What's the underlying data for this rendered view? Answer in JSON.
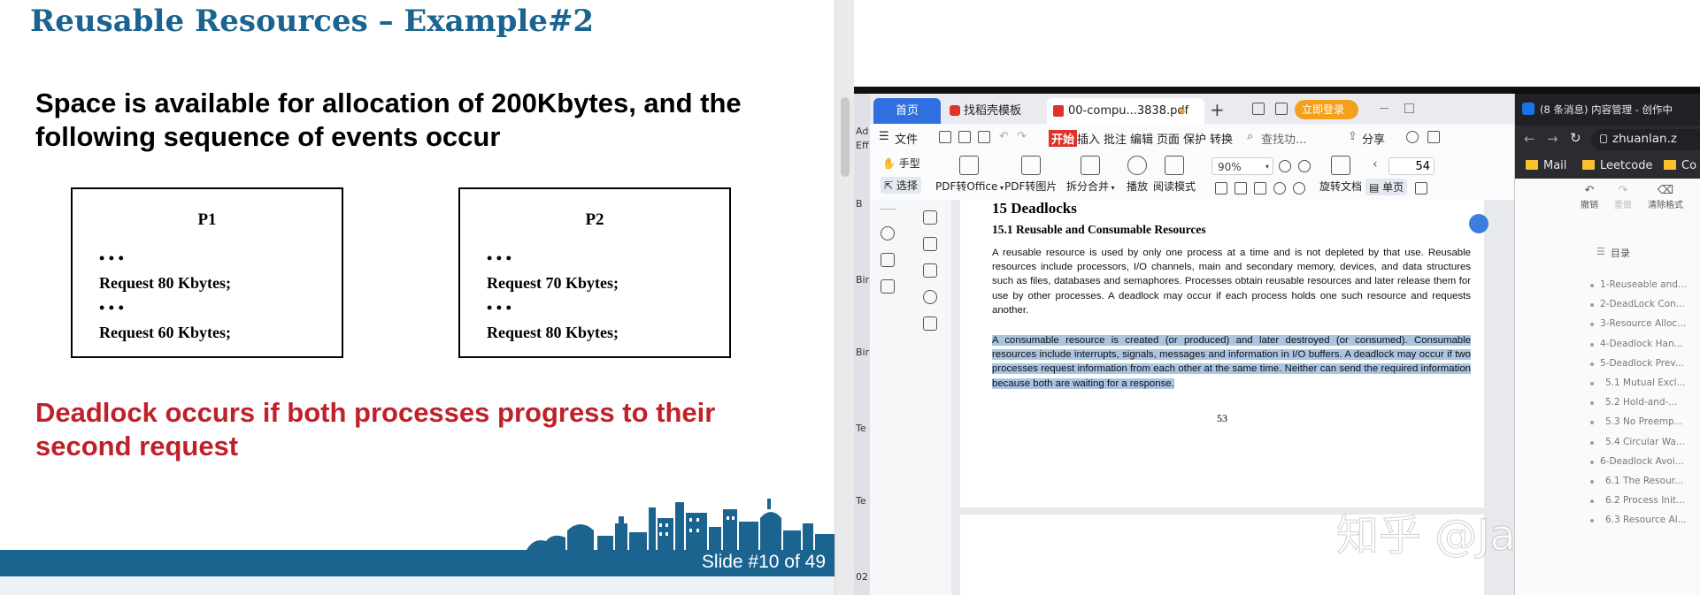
{
  "slide": {
    "title": "Reusable Resources – Example#2",
    "intro": "Space is available for allocation of 200Kbytes, and the following sequence of events occur",
    "processes": [
      {
        "name": "P1",
        "lines": [
          "• • •",
          "Request 80 Kbytes;",
          "• • •",
          "Request 60 Kbytes;"
        ]
      },
      {
        "name": "P2",
        "lines": [
          "• • •",
          "Request 70 Kbytes;",
          "• • •",
          "Request 80 Kbytes;"
        ]
      }
    ],
    "conclusion": "Deadlock occurs if both processes progress to their second request",
    "footer": "Slide #10 of 49",
    "colors": {
      "title": "#1b6490",
      "conclusion": "#c0202a",
      "footer_bar": "#1b6490"
    }
  },
  "desktop_left_labels": [
    "Ad",
    "Eff",
    "B",
    "Bir",
    "Bir",
    "Te",
    "Te",
    "02"
  ],
  "wps": {
    "tabs": [
      {
        "label": "首页",
        "active_color": "#2f6fe0"
      },
      {
        "label": "找稻壳模板"
      },
      {
        "label": "00-compu...3838.pdf"
      }
    ],
    "new_tab": "+",
    "login": "立即登录",
    "menu": {
      "file": "文件",
      "start": "开始",
      "items": [
        "插入",
        "批注",
        "编辑",
        "页面",
        "保护",
        "转换"
      ],
      "search": "查找功...",
      "share": "分享"
    },
    "toolbar": {
      "hand": "手型",
      "select": "选择",
      "pdf_to_office": "PDF转Office",
      "pdf_to_image": "PDF转图片",
      "split_merge": "拆分合并",
      "play": "播放",
      "read_mode": "阅读模式",
      "zoom": "90%",
      "rotate": "旋转文档",
      "page": "54",
      "single_page": "单页"
    },
    "doc": {
      "chapter": "15   Deadlocks",
      "section": "15.1   Reusable and Consumable Resources",
      "para1": "A reusable resource is used by only one process at a time and is not depleted by that use. Reusable resources include processors, I/O channels, main and secondary memory, devices, and data structures such as files, databases and semaphores. Processes obtain reusable resources and later release them for use by other processes. A deadlock may occur if each process holds one such resource and requests another.",
      "para2": "A consumable resource is created (or produced) and later destroyed (or consumed). Consumable resources include interrupts, signals, messages and information in I/O buffers. A deadlock may occur if two processes request information from each other at the same time. Neither can send the required information because both are waiting for a response.",
      "page_number": "53"
    }
  },
  "watermark": "知乎 @Jankin",
  "browser": {
    "tab_title": "(8 条消息) 内容管理 - 创作中",
    "address": "zhuanlan.z",
    "bookmarks": [
      "Mail",
      "Leetcode",
      "Co"
    ],
    "editor_tools": [
      "撤销",
      "重做",
      "清除格式"
    ],
    "toc_title": "目录",
    "toc_items": [
      "1-Reuseable and...",
      "2-DeadLock Con...",
      "3-Resource Alloc...",
      "4-Deadlock Han...",
      "5-Deadlock Prev...",
      "5.1 Mutual Excl...",
      "5.2 Hold-and-...",
      "5.3 No Preemp...",
      "5.4 Circular Wa...",
      "6-Deadlock Avoi...",
      "6.1 The Resour...",
      "6.2 Process Init...",
      "6.3 Resource Al..."
    ]
  }
}
